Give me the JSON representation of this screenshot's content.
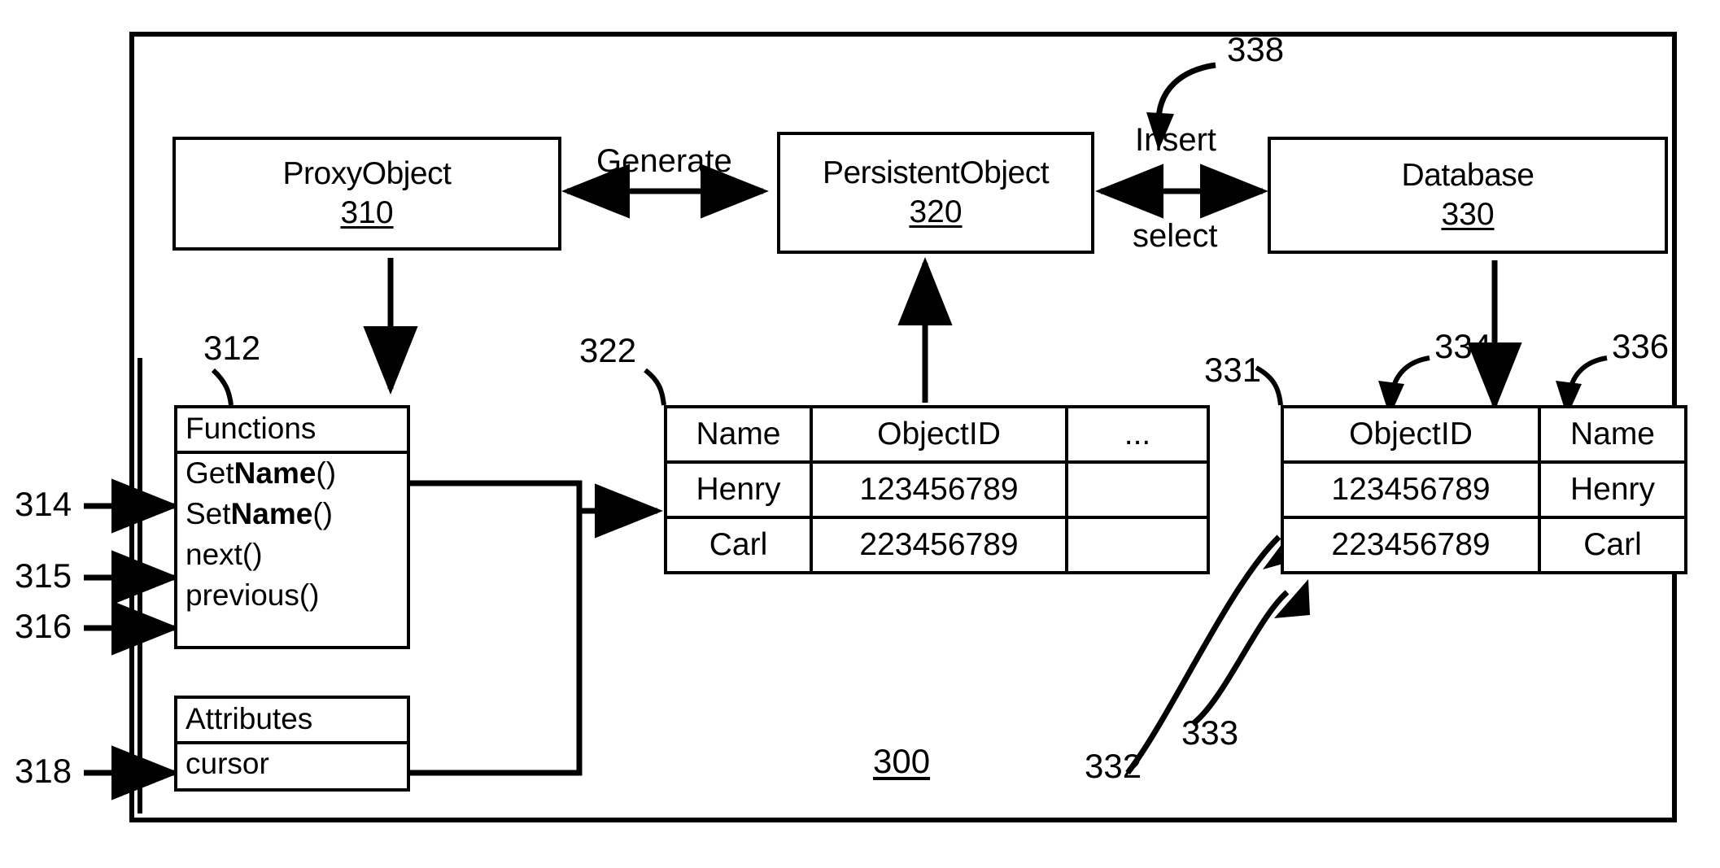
{
  "figure": {
    "figure_number": "300",
    "outer_frame": true
  },
  "nodes": {
    "proxy_object": {
      "title": "ProxyObject",
      "ref": "310"
    },
    "persistent_object": {
      "title": "PersistentObject",
      "ref": "320"
    },
    "database": {
      "title": "Database",
      "ref": "330"
    }
  },
  "edges": {
    "generate": "Generate",
    "insert": "Insert",
    "select": "select"
  },
  "proxy_detail": {
    "functions_ref": "312",
    "functions_header": "Functions",
    "functions": [
      {
        "prefix": "Get",
        "bold": "Name",
        "suffix": "()",
        "full": "GetName()"
      },
      {
        "prefix": "Set",
        "bold": "Name",
        "suffix": "()",
        "full": "SetName()"
      },
      {
        "prefix": "next()",
        "bold": "",
        "suffix": "",
        "full": "next()"
      },
      {
        "prefix": "previous()",
        "bold": "",
        "suffix": "",
        "full": "previous()"
      }
    ],
    "attributes_header": "Attributes",
    "attributes": [
      {
        "full": "cursor"
      }
    ],
    "callouts": {
      "get_set_name": "314",
      "next": "315",
      "previous": "316",
      "cursor": "318"
    }
  },
  "persistent_table": {
    "ref": "322",
    "headers": [
      "Name",
      "ObjectID",
      "..."
    ],
    "rows": [
      [
        "Henry",
        "123456789",
        ""
      ],
      [
        "Carl",
        "223456789",
        ""
      ]
    ]
  },
  "database_table": {
    "ref": "331",
    "column_callouts": {
      "object_id": "334",
      "name": "336"
    },
    "insert_arrow_callout": "338",
    "row_callouts": {
      "row1": "332",
      "row2": "333"
    },
    "headers": [
      "ObjectID",
      "Name"
    ],
    "rows": [
      [
        "123456789",
        "Henry"
      ],
      [
        "223456789",
        "Carl"
      ]
    ]
  }
}
